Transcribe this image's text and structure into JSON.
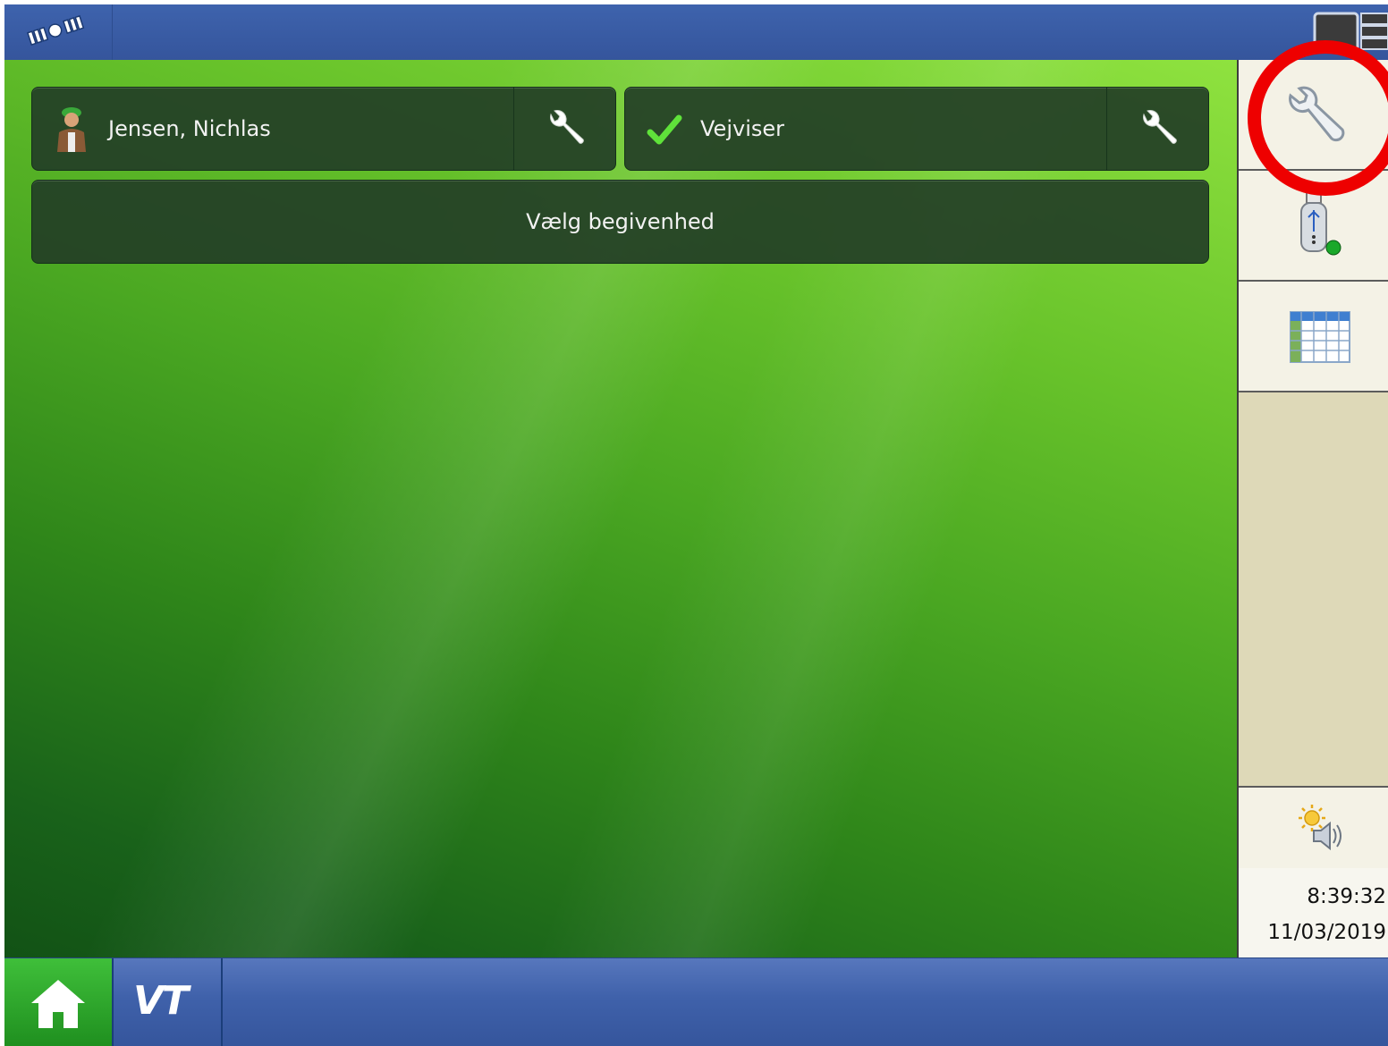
{
  "operator": {
    "name": "Jensen, Nichlas",
    "icon": "operator-avatar-icon"
  },
  "guidance": {
    "label": "Vejviser",
    "status_icon": "green-checkmark-icon"
  },
  "event": {
    "label": "Vælg begivenhed"
  },
  "sidebar": {
    "settings_icon": "wrench-icon",
    "usb_icon": "usb-drive-icon",
    "table_icon": "data-table-icon",
    "brightness_icon": "brightness-volume-icon",
    "time": "8:39:32",
    "date": "11/03/2019"
  },
  "bottombar": {
    "home_icon": "home-icon",
    "vt_label": "VT"
  },
  "colors": {
    "topbar": "#3e63ad",
    "panel": "#233e26",
    "sidebar": "#ded9b8",
    "highlight": "#ee0000",
    "home": "#2aa52a"
  }
}
